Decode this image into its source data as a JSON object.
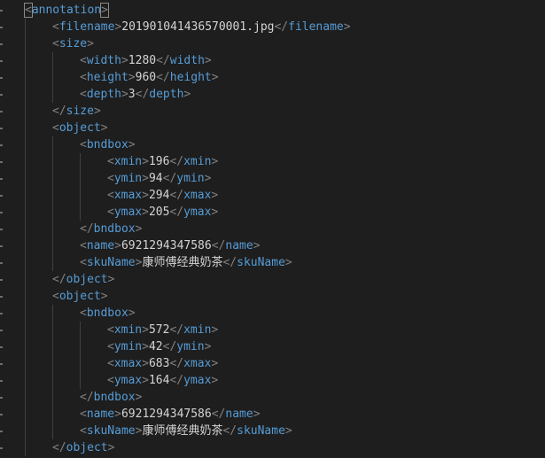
{
  "lines": [
    {
      "indent": 0,
      "kind": "open",
      "tag": "annotation"
    },
    {
      "indent": 1,
      "kind": "leaf",
      "tag": "filename",
      "value": "201901041436570001.jpg"
    },
    {
      "indent": 1,
      "kind": "open",
      "tag": "size"
    },
    {
      "indent": 2,
      "kind": "leaf",
      "tag": "width",
      "value": "1280"
    },
    {
      "indent": 2,
      "kind": "leaf",
      "tag": "height",
      "value": "960"
    },
    {
      "indent": 2,
      "kind": "leaf",
      "tag": "depth",
      "value": "3"
    },
    {
      "indent": 1,
      "kind": "close",
      "tag": "size"
    },
    {
      "indent": 1,
      "kind": "open",
      "tag": "object"
    },
    {
      "indent": 2,
      "kind": "open",
      "tag": "bndbox"
    },
    {
      "indent": 3,
      "kind": "leaf",
      "tag": "xmin",
      "value": "196"
    },
    {
      "indent": 3,
      "kind": "leaf",
      "tag": "ymin",
      "value": "94"
    },
    {
      "indent": 3,
      "kind": "leaf",
      "tag": "xmax",
      "value": "294"
    },
    {
      "indent": 3,
      "kind": "leaf",
      "tag": "ymax",
      "value": "205"
    },
    {
      "indent": 2,
      "kind": "close",
      "tag": "bndbox"
    },
    {
      "indent": 2,
      "kind": "leaf",
      "tag": "name",
      "value": "6921294347586"
    },
    {
      "indent": 2,
      "kind": "leaf",
      "tag": "skuName",
      "value": "康师傅经典奶茶"
    },
    {
      "indent": 1,
      "kind": "close",
      "tag": "object"
    },
    {
      "indent": 1,
      "kind": "open",
      "tag": "object"
    },
    {
      "indent": 2,
      "kind": "open",
      "tag": "bndbox"
    },
    {
      "indent": 3,
      "kind": "leaf",
      "tag": "xmin",
      "value": "572"
    },
    {
      "indent": 3,
      "kind": "leaf",
      "tag": "ymin",
      "value": "42"
    },
    {
      "indent": 3,
      "kind": "leaf",
      "tag": "xmax",
      "value": "683"
    },
    {
      "indent": 3,
      "kind": "leaf",
      "tag": "ymax",
      "value": "164"
    },
    {
      "indent": 2,
      "kind": "close",
      "tag": "bndbox"
    },
    {
      "indent": 2,
      "kind": "leaf",
      "tag": "name",
      "value": "6921294347586"
    },
    {
      "indent": 2,
      "kind": "leaf",
      "tag": "skuName",
      "value": "康师傅经典奶茶"
    },
    {
      "indent": 1,
      "kind": "close",
      "tag": "object"
    }
  ],
  "colors": {
    "background": "#1e1e1e",
    "tag": "#569cd6",
    "bracket": "#808080",
    "text": "#d4d4d4",
    "indent_guide": "#404040"
  }
}
